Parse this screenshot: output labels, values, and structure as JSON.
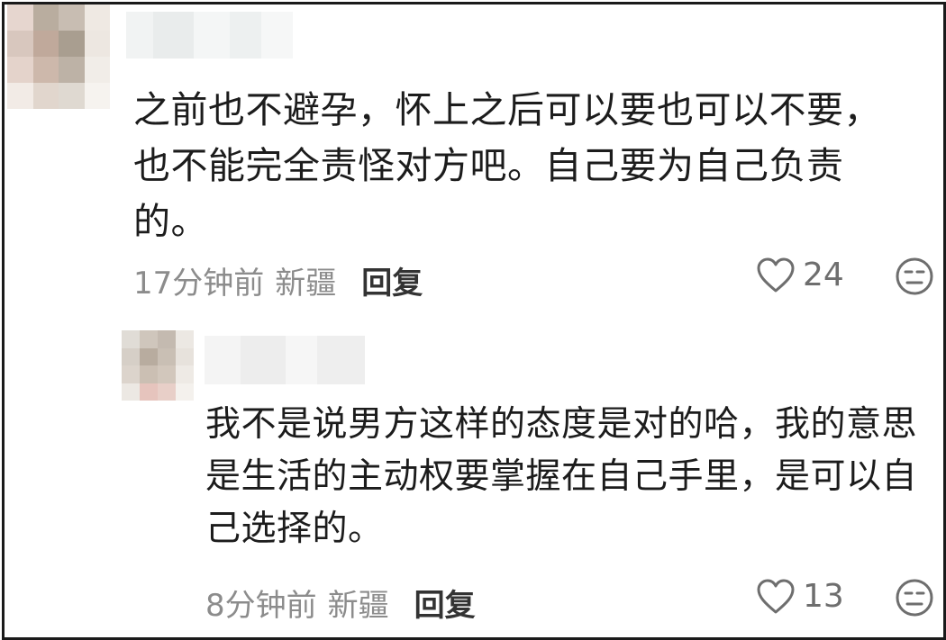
{
  "comments": [
    {
      "text": "之前也不避孕，怀上之后可以要也可以不要，也不能完全责怪对方吧。自己要为自己负责的。",
      "time": "17分钟前",
      "location": "新疆",
      "reply_label": "回复",
      "like_count": "24",
      "like_icon": "heart-outline-icon",
      "dislike_icon": "neutral-face-icon",
      "avatar_colors": [
        "#e6d6cf",
        "#b9ad9f",
        "#c8bdb2",
        "#efe9e3",
        "#d8c7be",
        "#c0a99b",
        "#a99e90",
        "#ede7e1",
        "#e4d3cb",
        "#cdb8ab",
        "#bdb2a6",
        "#f1ede8",
        "#f2ebe6",
        "#e1d6cd",
        "#dfd9d1",
        "#f6f3ef"
      ]
    },
    {
      "text": "我不是说男方这样的态度是对的哈，我的意思是生活的主动权要掌握在自己手里，是可以自己选择的。",
      "time": "8分钟前",
      "location": "新疆",
      "reply_label": "回复",
      "like_count": "13",
      "like_icon": "heart-outline-icon",
      "dislike_icon": "neutral-face-icon",
      "avatar_colors": [
        "#e0dcd6",
        "#cfc6bc",
        "#c4bab0",
        "#ece8e3",
        "#d6cfc7",
        "#b8ac9f",
        "#c9bfb4",
        "#e7e2dc",
        "#dcd4cc",
        "#cbbfb3",
        "#d2c7bc",
        "#eeeae5",
        "#ece8e3",
        "#e6c4bd",
        "#e8cfc8",
        "#f4f1ed"
      ]
    }
  ],
  "colors": {
    "text": "#1c1c1c",
    "meta": "#8c8c8c",
    "reply": "#333333",
    "icon": "#6e6e6e",
    "border": "#1a1a1a"
  }
}
